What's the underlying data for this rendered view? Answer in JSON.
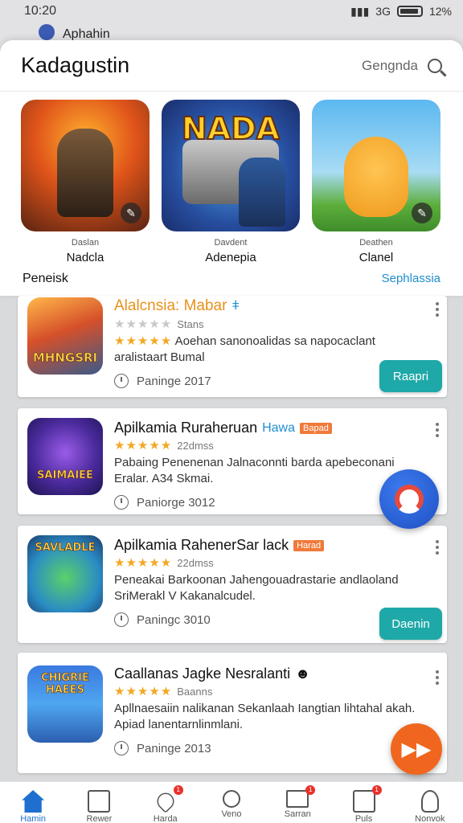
{
  "status_bar": {
    "time": "10:20",
    "battery_percent": "12%",
    "signal_text": "3G"
  },
  "behind_app": {
    "title": "Aphahin"
  },
  "sheet": {
    "title": "Kadagustin",
    "search_label": "Gengnda",
    "featured": [
      {
        "sub": "Daslan",
        "name": "Nadcla",
        "logo_text": ""
      },
      {
        "sub": "Davdent",
        "name": "Adenepia",
        "logo_text": "NADA"
      },
      {
        "sub": "Deathen",
        "name": "Clanel",
        "logo_text": ""
      }
    ],
    "footer_left": "Peneisk",
    "footer_right": "Sephlassia"
  },
  "list": [
    {
      "title": "Alalcnsia: Mabar",
      "title_accent": "",
      "title_tag": "",
      "rating_text": "Stans",
      "rating_value": 0,
      "description": "Aoehan sanonoalidas sa napocaclant aralistaart Bumal",
      "date": "Paninge 2017",
      "icon_text": "MHNGSRI",
      "cta": "Raapri"
    },
    {
      "title": "Apilkamia Ruraheruan",
      "title_accent": "Hawa",
      "title_tag": "Bapad",
      "rating_text": "22dmss",
      "rating_value": 5,
      "description": "Pabaing Penenenan Jalnaconnti barda apebeconani Eralar. A34 Skmai.",
      "date": "Paniorge 3012",
      "icon_text": "SAIMAIEE",
      "cta": ""
    },
    {
      "title": "Apilkamia RahenerSar lack",
      "title_accent": "",
      "title_tag": "Harad",
      "rating_text": "22dmss",
      "rating_value": 5,
      "description": "Peneakai Barkoonan Jahengouadrastarie andlaoland SriMerakl V Kakanalcudel.",
      "date": "Paningc 3010",
      "icon_text": "SAVLADLE",
      "cta": "Daenin"
    },
    {
      "title": "Caallanas Jagke Nesralanti",
      "title_accent": "",
      "title_tag": "",
      "rating_text": "Baanns",
      "rating_value": 5,
      "description": "Apllnaesaiin nalikanan Sekanlaah Iangtian lihtahal akah. Apiad lanentarnlinmlani.",
      "date": "Paninge 2013",
      "icon_text": "CHIGRIE HAEES",
      "cta": ""
    }
  ],
  "bottom_nav": [
    {
      "label": "Hamin",
      "icon": "home-icon",
      "badge": ""
    },
    {
      "label": "Rewer",
      "icon": "document-icon",
      "badge": ""
    },
    {
      "label": "Harda",
      "icon": "heart-icon",
      "badge": "1"
    },
    {
      "label": "Veno",
      "icon": "search-icon",
      "badge": ""
    },
    {
      "label": "Sarran",
      "icon": "mail-icon",
      "badge": "1"
    },
    {
      "label": "Puls",
      "icon": "inbox-icon",
      "badge": "1"
    },
    {
      "label": "Nonvok",
      "icon": "person-icon",
      "badge": ""
    }
  ],
  "colors": {
    "accent": "#1e8fd0",
    "cta": "#1fa8a8",
    "fab_orange": "#f0661e",
    "star": "#f3a823"
  }
}
